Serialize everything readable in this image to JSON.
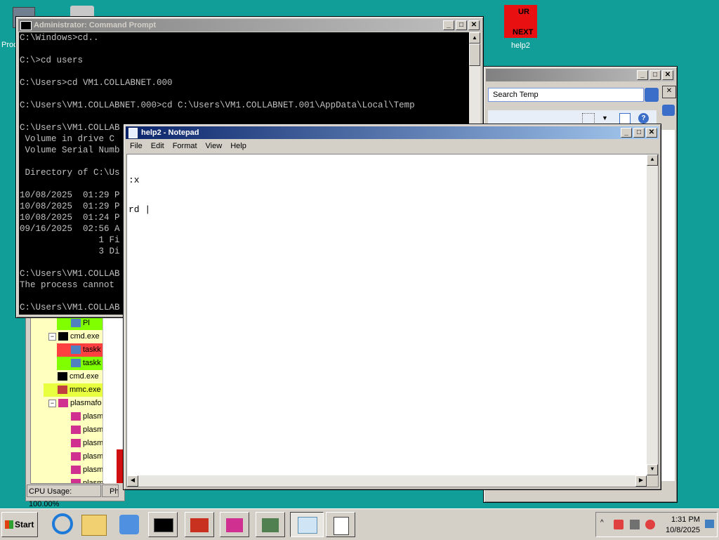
{
  "desktop": {
    "icons": [
      {
        "label": "Proc"
      },
      {
        "label": "help2",
        "badge_top": "UR",
        "badge_bottom": "NEXT"
      }
    ]
  },
  "cmd": {
    "title": "Administrator: Command Prompt",
    "lines": [
      "C:\\Windows>cd..",
      "",
      "C:\\>cd users",
      "",
      "C:\\Users>cd VM1.COLLABNET.000",
      "",
      "C:\\Users\\VM1.COLLABNET.000>cd C:\\Users\\VM1.COLLABNET.001\\AppData\\Local\\Temp",
      "",
      "C:\\Users\\VM1.COLLAB",
      " Volume in drive C",
      " Volume Serial Numb",
      "",
      " Directory of C:\\Us",
      "",
      "10/08/2025  01:29 P",
      "10/08/2025  01:29 P",
      "10/08/2025  01:24 P",
      "09/16/2025  02:56 A",
      "               1 Fi",
      "               3 Di",
      "",
      "C:\\Users\\VM1.COLLAB",
      "The process cannot",
      "",
      "C:\\Users\\VM1.COLLAB"
    ]
  },
  "explorer": {
    "search_placeholder": "Search Temp"
  },
  "notepad": {
    "title": "help2 - Notepad",
    "menu": [
      "File",
      "Edit",
      "Format",
      "View",
      "Help"
    ],
    "content_lines": [
      ":x",
      "rd |"
    ]
  },
  "process_explorer": {
    "rows": [
      {
        "label": "Pl",
        "indent": 3,
        "icon": "window",
        "bg": "#80ff00"
      },
      {
        "label": "cmd.exe",
        "indent": 2,
        "icon": "cmd",
        "bg": "#ffffc0",
        "expander": "−"
      },
      {
        "label": "taskk",
        "indent": 3,
        "icon": "window",
        "bg": "#ff4040"
      },
      {
        "label": "taskk",
        "indent": 3,
        "icon": "window",
        "bg": "#80ff00"
      },
      {
        "label": "cmd.exe",
        "indent": 2,
        "icon": "cmd",
        "bg": "#ffffc0"
      },
      {
        "label": "mmc.exe",
        "indent": 2,
        "icon": "mmc",
        "bg": "#e8ff40"
      },
      {
        "label": "plasmafo",
        "indent": 2,
        "icon": "plasma",
        "bg": "#ffffc0",
        "expander": "−"
      },
      {
        "label": "plasm",
        "indent": 3,
        "icon": "plasma",
        "bg": "#ffffc0"
      },
      {
        "label": "plasm",
        "indent": 3,
        "icon": "plasma",
        "bg": "#ffffc0"
      },
      {
        "label": "plasm",
        "indent": 3,
        "icon": "plasma",
        "bg": "#ffffc0"
      },
      {
        "label": "plasm",
        "indent": 3,
        "icon": "plasma",
        "bg": "#ffffc0"
      },
      {
        "label": "plasm",
        "indent": 3,
        "icon": "plasma",
        "bg": "#ffffc0"
      },
      {
        "label": "plasm",
        "indent": 3,
        "icon": "plasma",
        "bg": "#ffffc0"
      }
    ],
    "status": "CPU Usage: 100.00%",
    "status2": "Ph"
  },
  "taskbar": {
    "start_label": "Start",
    "quick_launch": [
      "ie-icon",
      "folder-icon",
      "media-player-icon"
    ],
    "tasks": [
      "cmd-icon",
      "toolbox-icon",
      "plasma-icon",
      "network-icon",
      "notepad-icon",
      "console-icon"
    ],
    "clock_time": "1:31 PM",
    "clock_date": "10/8/2025",
    "colors": {
      "taskbar": "#d4d0c8",
      "title_active": "#0a246a"
    }
  }
}
